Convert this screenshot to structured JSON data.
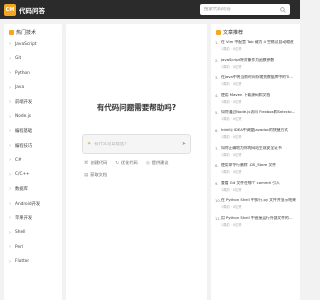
{
  "header": {
    "logo_badge": "CM",
    "logo_text": "代码问答",
    "search_placeholder": "搜索代码问答"
  },
  "sidebar": {
    "section_title": "热门技术",
    "items": [
      {
        "label": "JavaScript"
      },
      {
        "label": "Git"
      },
      {
        "label": "Python"
      },
      {
        "label": "Java"
      },
      {
        "label": "前端开发"
      },
      {
        "label": "Node.js"
      },
      {
        "label": "编程基础"
      },
      {
        "label": "编程技巧"
      },
      {
        "label": "C#"
      },
      {
        "label": "C/C++"
      },
      {
        "label": "数据库"
      },
      {
        "label": "Android开发"
      },
      {
        "label": "苹果开发"
      },
      {
        "label": "Shell"
      },
      {
        "label": "Perl"
      },
      {
        "label": "Flutter"
      }
    ]
  },
  "main": {
    "title": "有代码问题需要帮助吗?",
    "ask_placeholder": "有什么可以帮您?",
    "chips": [
      {
        "label": "创建代码",
        "icon": "code-icon"
      },
      {
        "label": "优化代码",
        "icon": "refresh-icon"
      },
      {
        "label": "提供建议",
        "icon": "lightbulb-icon"
      }
    ],
    "chip_row2": {
      "label": "获取文档",
      "icon": "document-icon"
    }
  },
  "right": {
    "section_title": "文章推荐",
    "articles": [
      {
        "num": "1.",
        "title": "在 Vim 中配置 Tab 键为 4 空格及自动缩进",
        "meta": "1周前 · 0位赞"
      },
      {
        "num": "2.",
        "title": "JavaScript将对象作为函数参数",
        "meta": "1周前 · 0位赞"
      },
      {
        "num": "3.",
        "title": "在Java中将当前时间存储到数据库中的Timestamp字段",
        "meta": "1周前 · 0位赞"
      },
      {
        "num": "4.",
        "title": "使用 Maven 下载源码和文档",
        "meta": "1周前 · 0位赞"
      },
      {
        "num": "5.",
        "title": "如何通过Node.js访问 Flexbox和Selector的提示",
        "meta": "1周前 · 0位赞"
      },
      {
        "num": "6.",
        "title": "Intellij IDEA中调整Javadoc的快捷方式",
        "meta": "1周前 · 0位赞"
      },
      {
        "num": "7.",
        "title": "如何正确地为你的网站生成安全证书",
        "meta": "1周前 · 0位赞"
      },
      {
        "num": "8.",
        "title": "使用命令行删除 .DS_Store 文件",
        "meta": "1周前 · 0位赞"
      },
      {
        "num": "9.",
        "title": "查看 Git 文件在哪个 commit 引入",
        "meta": "1周前 · 0位赞"
      },
      {
        "num": "10.",
        "title": "在 Python Shell 中执行.py 文件并显示结果",
        "meta": "1周前 · 0位赞"
      },
      {
        "num": "11.",
        "title": "用 Python Shell 中直接运行外部文件的方法",
        "meta": "1周前 · 0位赞"
      }
    ]
  }
}
